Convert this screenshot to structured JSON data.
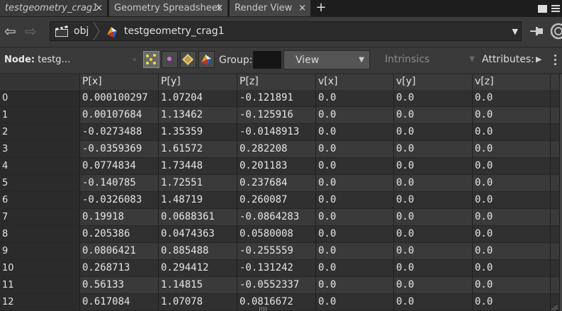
{
  "tabs": [
    {
      "label": "testgeometry_crag1",
      "close": "×",
      "italic": true,
      "active": true
    },
    {
      "label": "Geometry Spreadsheet",
      "close": "×",
      "italic": false,
      "active": false
    },
    {
      "label": "Render View",
      "close": "×",
      "italic": false,
      "active": false
    }
  ],
  "tab_add": "+",
  "pathbar": {
    "back": "⇦",
    "forward": "⇨",
    "obj": "obj",
    "node_path": "testgeometry_crag1",
    "dropdown": "▼"
  },
  "nodebar": {
    "node_label": "Node:",
    "node_value": "testg…",
    "left_arrow": "◂",
    "group_label": "Group:",
    "view_label": "View",
    "view_arrow": "▼",
    "intrinsics_label": "Intrinsics",
    "intrinsics_arrow": "▼",
    "attributes_label": "Attributes:",
    "attr_arrow": "▶"
  },
  "table": {
    "columns": [
      "",
      "P[x]",
      "P[y]",
      "P[z]",
      "v[x]",
      "v[y]",
      "v[z]"
    ],
    "rows": [
      [
        "0",
        "0.000100297",
        "1.07204",
        "-0.121891",
        "0.0",
        "0.0",
        "0.0"
      ],
      [
        "1",
        "0.00107684",
        "1.13462",
        "-0.125916",
        "0.0",
        "0.0",
        "0.0"
      ],
      [
        "2",
        "-0.0273488",
        "1.35359",
        "-0.0148913",
        "0.0",
        "0.0",
        "0.0"
      ],
      [
        "3",
        "-0.0359369",
        "1.61572",
        "0.282208",
        "0.0",
        "0.0",
        "0.0"
      ],
      [
        "4",
        "0.0774834",
        "1.73448",
        "0.201183",
        "0.0",
        "0.0",
        "0.0"
      ],
      [
        "5",
        "-0.140785",
        "1.72551",
        "0.237684",
        "0.0",
        "0.0",
        "0.0"
      ],
      [
        "6",
        "-0.0326083",
        "1.48719",
        "0.260087",
        "0.0",
        "0.0",
        "0.0"
      ],
      [
        "7",
        "0.19918",
        "0.0688361",
        "-0.0864283",
        "0.0",
        "0.0",
        "0.0"
      ],
      [
        "8",
        "0.205386",
        "0.0474363",
        "0.0580008",
        "0.0",
        "0.0",
        "0.0"
      ],
      [
        "9",
        "0.0806421",
        "0.885488",
        "-0.255559",
        "0.0",
        "0.0",
        "0.0"
      ],
      [
        "10",
        "0.268713",
        "0.294412",
        "-0.131242",
        "0.0",
        "0.0",
        "0.0"
      ],
      [
        "11",
        "0.56133",
        "1.14815",
        "-0.0552337",
        "0.0",
        "0.0",
        "0.0"
      ],
      [
        "12",
        "0.617084",
        "1.07078",
        "0.0816672",
        "0.0",
        "0.0",
        "0.0"
      ]
    ]
  }
}
